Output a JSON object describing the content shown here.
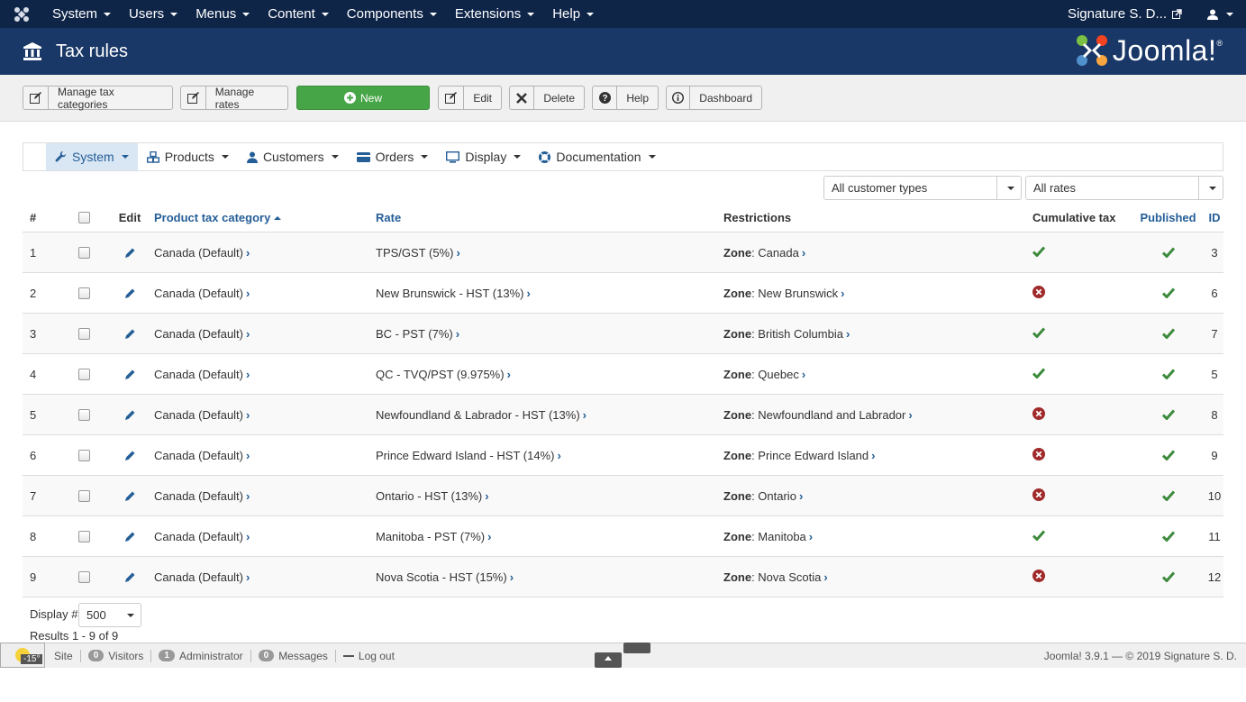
{
  "topnav": {
    "menu": [
      "System",
      "Users",
      "Menus",
      "Content",
      "Components",
      "Extensions",
      "Help"
    ],
    "user_site": "Signature S. D...",
    "colors": {
      "bg": "#0f2548"
    }
  },
  "header": {
    "title": "Tax rules",
    "brand": "Joomla!",
    "brand_mark": "®"
  },
  "toolbar": {
    "manage_categories": "Manage tax categories",
    "manage_rates": "Manage rates",
    "new": "New",
    "edit": "Edit",
    "delete": "Delete",
    "help": "Help",
    "dashboard": "Dashboard"
  },
  "submenu": [
    "System",
    "Products",
    "Customers",
    "Orders",
    "Display",
    "Documentation"
  ],
  "filters": {
    "customer_types": "All customer types",
    "rates": "All rates"
  },
  "table": {
    "headers": {
      "num": "#",
      "edit": "Edit",
      "category": "Product tax category",
      "rate": "Rate",
      "restrictions": "Restrictions",
      "cumulative": "Cumulative tax",
      "published": "Published",
      "id": "ID"
    },
    "zone_label": "Zone",
    "rows": [
      {
        "num": "1",
        "category": "Canada (Default)",
        "rate": "TPS/GST (5%)",
        "zone": "Canada",
        "cumulative": true,
        "published": true,
        "id": "3"
      },
      {
        "num": "2",
        "category": "Canada (Default)",
        "rate": "New Brunswick - HST (13%)",
        "zone": "New Brunswick",
        "cumulative": false,
        "published": true,
        "id": "6"
      },
      {
        "num": "3",
        "category": "Canada (Default)",
        "rate": "BC - PST (7%)",
        "zone": "British Columbia",
        "cumulative": true,
        "published": true,
        "id": "7"
      },
      {
        "num": "4",
        "category": "Canada (Default)",
        "rate": "QC - TVQ/PST (9.975%)",
        "zone": "Quebec",
        "cumulative": true,
        "published": true,
        "id": "5"
      },
      {
        "num": "5",
        "category": "Canada (Default)",
        "rate": "Newfoundland & Labrador - HST (13%)",
        "zone": "Newfoundland and Labrador",
        "cumulative": false,
        "published": true,
        "id": "8"
      },
      {
        "num": "6",
        "category": "Canada (Default)",
        "rate": "Prince Edward Island - HST (14%)",
        "zone": "Prince Edward Island",
        "cumulative": false,
        "published": true,
        "id": "9"
      },
      {
        "num": "7",
        "category": "Canada (Default)",
        "rate": "Ontario - HST (13%)",
        "zone": "Ontario",
        "cumulative": false,
        "published": true,
        "id": "10"
      },
      {
        "num": "8",
        "category": "Canada (Default)",
        "rate": "Manitoba - PST (7%)",
        "zone": "Manitoba",
        "cumulative": true,
        "published": true,
        "id": "11"
      },
      {
        "num": "9",
        "category": "Canada (Default)",
        "rate": "Nova Scotia - HST (15%)",
        "zone": "Nova Scotia",
        "cumulative": false,
        "published": true,
        "id": "12"
      }
    ]
  },
  "list_footer": {
    "display_label": "Display #",
    "display_value": "500",
    "results": "Results 1 - 9 of 9"
  },
  "statusbar": {
    "temp": "-15°",
    "site": "Site",
    "visitors_count": "0",
    "visitors": "Visitors",
    "admins_count": "1",
    "admins": "Administrator",
    "messages_count": "0",
    "messages": "Messages",
    "logout": "Log out",
    "copyright": "Joomla! 3.9.1 — © 2019 Signature S. D."
  },
  "colors": {
    "accent": "#245e97",
    "check": "#3c8a3c",
    "cross": "#a02a2a",
    "new_button": "#46a546"
  }
}
